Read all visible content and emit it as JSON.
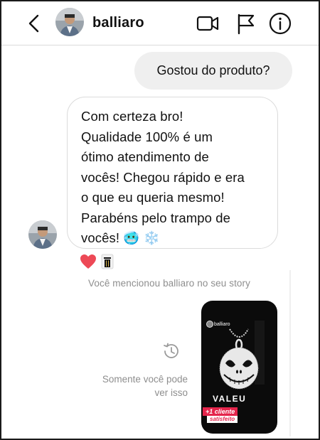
{
  "header": {
    "username": "balliaro",
    "back_icon": "chevron-left-icon",
    "video_icon": "video-camera-icon",
    "flag_icon": "flag-icon",
    "info_icon": "info-icon"
  },
  "messages": {
    "outgoing_1": "Gostou do produto?",
    "incoming_1": "Com certeza bro!\nQualidade 100% é um\nótimo atendimento de\nvocês! Chegou rápido e era\no que eu queria mesmo!\nParabéns pelo trampo de\nvocês! 🥶 ❄️"
  },
  "reactions": {
    "heart": "❤️",
    "other": "🗑️"
  },
  "story_reply": {
    "mention_text": "Você mencionou balliaro no seu story",
    "only_you_text": "Somente você pode ver isso",
    "story": {
      "username": "balliaro",
      "valeu": "VALEU",
      "tag": "+1 cliente",
      "sub": "satisfeito"
    }
  },
  "colors": {
    "outgoing_bubble": "#efefef",
    "incoming_border": "#dbdbdb",
    "muted_text": "#8e8e8e",
    "heart": "#ed4956",
    "story_accent": "#e4244b"
  }
}
